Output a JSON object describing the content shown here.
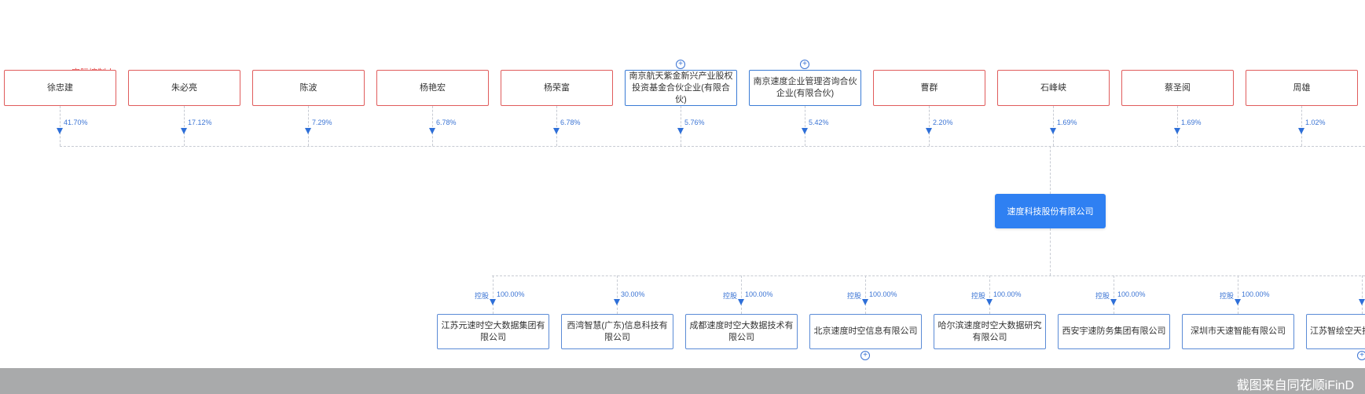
{
  "controller_tag": "实际控制人",
  "company": {
    "name": "速度科技股份有限公司"
  },
  "shareholders": [
    {
      "name": "徐忠建",
      "pct": "41.70%",
      "type": "person"
    },
    {
      "name": "朱必亮",
      "pct": "17.12%",
      "type": "person"
    },
    {
      "name": "陈波",
      "pct": "7.29%",
      "type": "person"
    },
    {
      "name": "杨艳宏",
      "pct": "6.78%",
      "type": "person"
    },
    {
      "name": "杨荣富",
      "pct": "6.78%",
      "type": "person"
    },
    {
      "name": "南京航天紫金新兴产业股权投资基金合伙企业(有限合伙)",
      "pct": "5.76%",
      "type": "org"
    },
    {
      "name": "南京速度企业管理咨询合伙企业(有限合伙)",
      "pct": "5.42%",
      "type": "org"
    },
    {
      "name": "曹群",
      "pct": "2.20%",
      "type": "person"
    },
    {
      "name": "石峰峡",
      "pct": "1.69%",
      "type": "person"
    },
    {
      "name": "蔡圣阅",
      "pct": "1.69%",
      "type": "person"
    },
    {
      "name": "周雄",
      "pct": "1.02%",
      "type": "person"
    }
  ],
  "subsidiaries": [
    {
      "name": "江苏元速时空大数据集团有限公司",
      "ctrl": "控股",
      "pct": "100.00%"
    },
    {
      "name": "西湾智慧(广东)信息科技有限公司",
      "ctrl": "",
      "pct": "30.00%"
    },
    {
      "name": "成都速度时空大数据技术有限公司",
      "ctrl": "控股",
      "pct": "100.00%"
    },
    {
      "name": "北京速度时空信息有限公司",
      "ctrl": "控股",
      "pct": "100.00%"
    },
    {
      "name": "哈尔滨速度时空大数据研究有限公司",
      "ctrl": "控股",
      "pct": "100.00%"
    },
    {
      "name": "西安宇速防务集团有限公司",
      "ctrl": "控股",
      "pct": "100.00%"
    },
    {
      "name": "深圳市天速智能有限公司",
      "ctrl": "控股",
      "pct": "100.00%"
    },
    {
      "name": "江苏智绘空天技",
      "ctrl": "",
      "pct": ""
    }
  ],
  "expand_symbol": "+",
  "watermark": "截图来自同花顺iFinD",
  "colors": {
    "person_border": "#e05c5c",
    "org_border": "#3a7bd5",
    "accent": "#2f80f2",
    "percent_text": "#3b74d4"
  }
}
